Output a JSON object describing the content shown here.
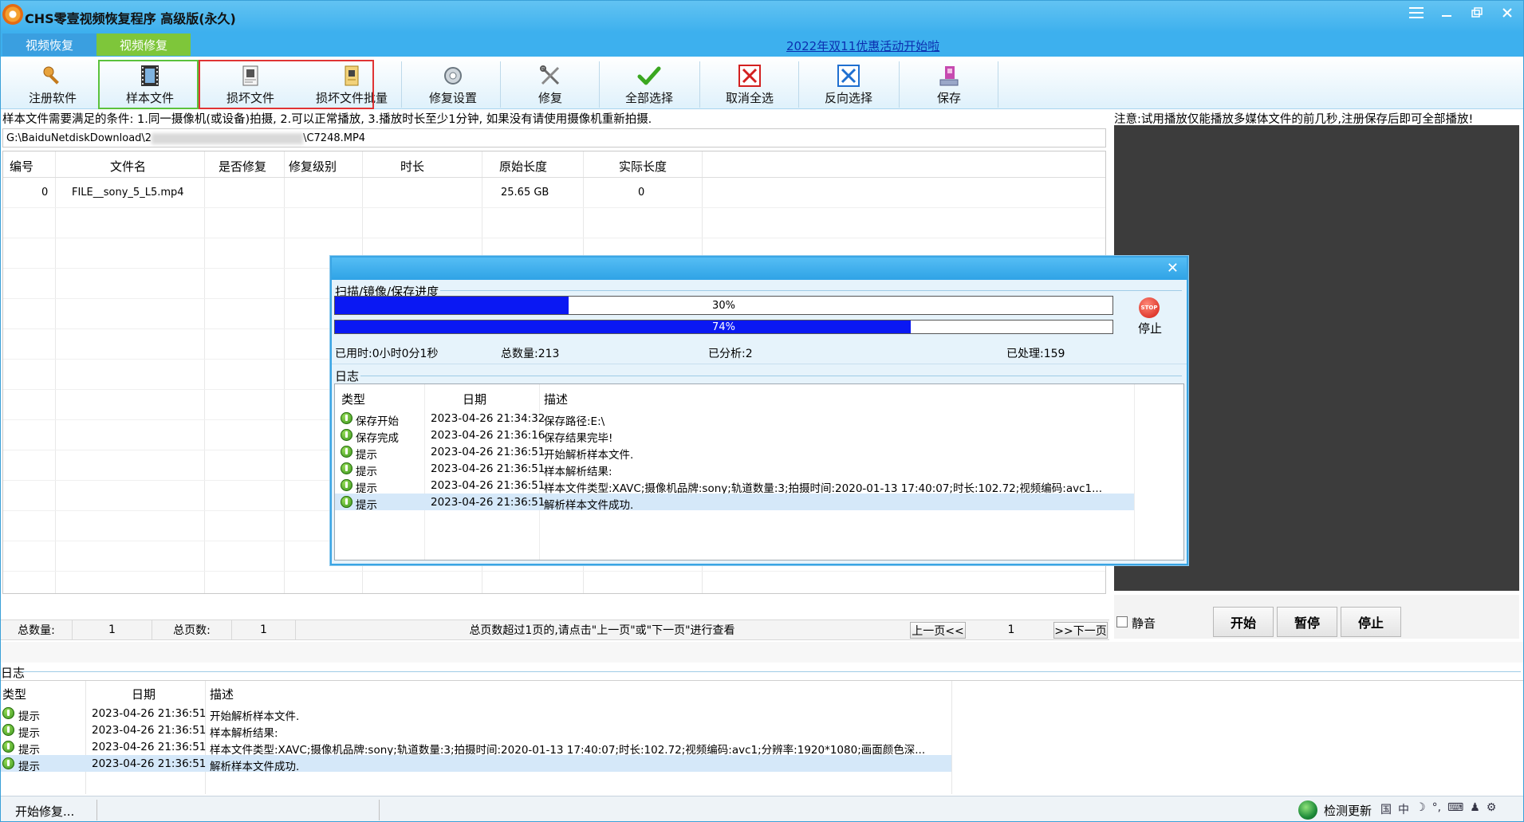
{
  "window": {
    "title": "CHS零壹视频恢复程序 高级版(永久)",
    "accent": "#3db0ee",
    "controls": [
      "menu-icon",
      "minimize-icon",
      "restore-icon",
      "close-icon"
    ]
  },
  "tabs": [
    {
      "label": "视频恢复",
      "active": false
    },
    {
      "label": "视频修复",
      "active": true
    }
  ],
  "promo_link": "2022年双11优惠活动开始啦",
  "toolbar": [
    {
      "label": "注册软件",
      "icon": "key-icon"
    },
    {
      "label": "样本文件",
      "icon": "film-icon"
    },
    {
      "label": "损坏文件",
      "icon": "broken-file-icon"
    },
    {
      "label": "损坏文件批量",
      "icon": "batch-file-icon"
    },
    {
      "label": "修复设置",
      "icon": "settings-icon"
    },
    {
      "label": "修复",
      "icon": "tools-icon"
    },
    {
      "label": "全部选择",
      "icon": "check-icon"
    },
    {
      "label": "取消全选",
      "icon": "red-x-icon"
    },
    {
      "label": "反向选择",
      "icon": "blue-x-icon"
    },
    {
      "label": "保存",
      "icon": "save-disk-icon"
    }
  ],
  "notice": "样本文件需要满足的条件: 1.同一摄像机(或设备)拍摄, 2.可以正常播放, 3.播放时长至少1分钟, 如果没有请使用摄像机重新拍摄.",
  "player_notice": "注意:试用播放仅能播放多媒体文件的前几秒,注册保存后即可全部播放!",
  "path": {
    "prefix": "G:\\BaiduNetdiskDownload\\2",
    "suffix": "\\C7248.MP4"
  },
  "grid": {
    "headers": [
      "编号",
      "文件名",
      "是否修复",
      "修复级别",
      "时长",
      "原始长度",
      "实际长度"
    ],
    "rows": [
      {
        "id": "0",
        "name": "FILE__sony_5_L5.mp4",
        "repaired": "",
        "level": "",
        "duration": "",
        "original": "25.65 GB",
        "actual": "0"
      }
    ]
  },
  "pager": {
    "total_label": "总数量:",
    "total": "1",
    "pages_label": "总页数:",
    "pages": "1",
    "hint": "总页数超过1页的,请点击\"上一页\"或\"下一页\"进行查看",
    "prev": "上一页<<",
    "current": "1",
    "next": ">>下一页"
  },
  "player": {
    "mute_label": "静音",
    "start": "开始",
    "pause": "暂停",
    "stop": "停止"
  },
  "bottom_log": {
    "title": "日志",
    "headers": [
      "类型",
      "日期",
      "描述"
    ],
    "rows": [
      {
        "type": "提示",
        "date": "2023-04-26 21:36:51",
        "desc": "开始解析样本文件."
      },
      {
        "type": "提示",
        "date": "2023-04-26 21:36:51",
        "desc": "样本解析结果:"
      },
      {
        "type": "提示",
        "date": "2023-04-26 21:36:51",
        "desc": "样本文件类型:XAVC;摄像机品牌:sony;轨道数量:3;拍摄时间:2020-01-13 17:40:07;时长:102.72;视频编码:avc1;分辨率:1920*1080;画面颜色深..."
      },
      {
        "type": "提示",
        "date": "2023-04-26 21:36:51",
        "desc": "解析样本文件成功."
      }
    ]
  },
  "statusbar": {
    "text": "开始修复...",
    "update": "检测更新",
    "tray": [
      "国",
      "中",
      "☽",
      "°,",
      "⌨",
      "♟",
      "⚙"
    ]
  },
  "dialog": {
    "section_title": "扫描/镜像/保存进度",
    "progress1": {
      "percent": 30,
      "label": "30%"
    },
    "progress2": {
      "percent": 74,
      "label": "74%"
    },
    "stop_badge": "STOP",
    "stop_label": "停止",
    "stats": {
      "elapsed": "已用时:0小时0分1秒",
      "total": "总数量:213",
      "analyzed": "已分析:2",
      "processed": "已处理:159"
    },
    "log_title": "日志",
    "log_headers": [
      "类型",
      "日期",
      "描述"
    ],
    "log_rows": [
      {
        "type": "保存开始",
        "date": "2023-04-26 21:34:32",
        "desc": "保存路径:E:\\"
      },
      {
        "type": "保存完成",
        "date": "2023-04-26 21:36:16",
        "desc": "保存结果完毕!"
      },
      {
        "type": "提示",
        "date": "2023-04-26 21:36:51",
        "desc": "开始解析样本文件."
      },
      {
        "type": "提示",
        "date": "2023-04-26 21:36:51",
        "desc": "样本解析结果:"
      },
      {
        "type": "提示",
        "date": "2023-04-26 21:36:51",
        "desc": "样本文件类型:XAVC;摄像机品牌:sony;轨道数量:3;拍摄时间:2020-01-13 17:40:07;时长:102.72;视频编码:avc1..."
      },
      {
        "type": "提示",
        "date": "2023-04-26 21:36:51",
        "desc": "解析样本文件成功."
      }
    ]
  }
}
